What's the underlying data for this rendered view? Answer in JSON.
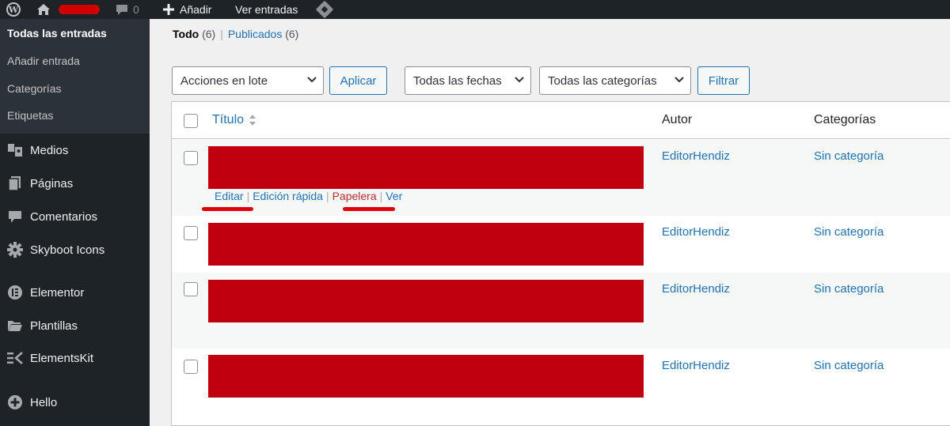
{
  "adminbar": {
    "comment_count": "0",
    "add_new": "Añadir",
    "view_posts": "Ver entradas"
  },
  "sidebar": {
    "submenu": [
      "Todas las entradas",
      "Añadir entrada",
      "Categorías",
      "Etiquetas"
    ],
    "menu": [
      {
        "label": "Medios",
        "icon": "media-icon"
      },
      {
        "label": "Páginas",
        "icon": "pages-icon"
      },
      {
        "label": "Comentarios",
        "icon": "comments-icon"
      },
      {
        "label": "Skyboot Icons",
        "icon": "gear-icon"
      },
      {
        "label": "Elementor",
        "icon": "elementor-icon"
      },
      {
        "label": "Plantillas",
        "icon": "folder-icon"
      },
      {
        "label": "ElementsKit",
        "icon": "elementskit-icon"
      },
      {
        "label": "Hello",
        "icon": "plus-circle-icon"
      }
    ]
  },
  "filters": {
    "all": "Todo",
    "all_count": "(6)",
    "published": "Publicados",
    "published_count": "(6)"
  },
  "toolbar": {
    "bulk_actions": "Acciones en lote",
    "apply": "Aplicar",
    "dates": "Todas las fechas",
    "categories": "Todas las categorías",
    "filter": "Filtrar"
  },
  "table": {
    "columns": {
      "title": "Título",
      "author": "Autor",
      "categories": "Categorías"
    },
    "rows": [
      {
        "author": "EditorHendiz",
        "category": "Sin categoría"
      },
      {
        "author": "EditorHendiz",
        "category": "Sin categoría"
      },
      {
        "author": "EditorHendiz",
        "category": "Sin categoría"
      },
      {
        "author": "EditorHendiz",
        "category": "Sin categoría"
      }
    ],
    "row_actions": {
      "edit": "Editar",
      "quick_edit": "Edición rápida",
      "trash": "Papelera",
      "view": "Ver"
    }
  },
  "colors": {
    "admin_bar": "#1d2327",
    "submenu_bg": "#2c3338",
    "link": "#2271b1",
    "trash": "#b32d2e",
    "redaction": "#c1000f",
    "annotation": "#e00000"
  }
}
